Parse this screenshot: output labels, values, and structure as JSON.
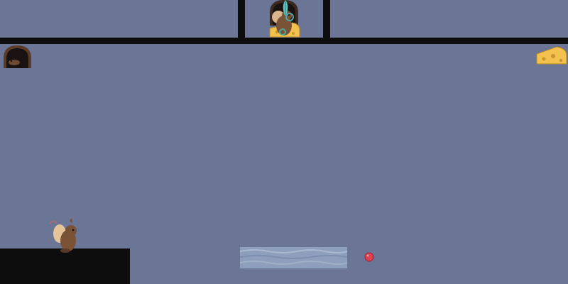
{
  "scene": {
    "background_color": "#6b7596",
    "platform_color": "#0d0d0d",
    "water_color": "#8d9fbd",
    "button_color": "#e0414f"
  },
  "entities": {
    "player_mouse": {
      "icon": "mouse-icon"
    },
    "mouse_hole_left": {
      "icon": "mouse-hole-icon"
    },
    "mouse_hole_top": {
      "icon": "mouse-hole-icon"
    },
    "cheese_top": {
      "icon": "cheese-icon"
    },
    "cheese_right": {
      "icon": "cheese-icon"
    },
    "feather": {
      "icon": "feather-icon"
    },
    "red_button": {
      "icon": "red-button-icon"
    },
    "water_pool": {
      "icon": "water-icon"
    }
  }
}
